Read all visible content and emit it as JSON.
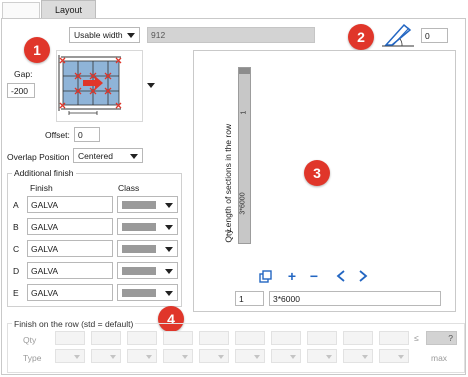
{
  "tabs": {
    "active": "Layout"
  },
  "top": {
    "width_mode": "Usable width",
    "width_value": "912",
    "angle_value": "0"
  },
  "badges": [
    "1",
    "2",
    "3",
    "4"
  ],
  "left": {
    "gap_label": "Gap:",
    "gap_value": "-200",
    "offset_label": "Offset:",
    "offset_value": "0",
    "overlap_label": "Overlap Position",
    "overlap_value": "Centered"
  },
  "additional_finish": {
    "title": "Additional finish",
    "col_finish": "Finish",
    "col_class": "Class",
    "rows": [
      {
        "letter": "A",
        "finish": "GALVA"
      },
      {
        "letter": "B",
        "finish": "GALVA"
      },
      {
        "letter": "C",
        "finish": "GALVA"
      },
      {
        "letter": "D",
        "finish": "GALVA"
      },
      {
        "letter": "E",
        "finish": "GALVA"
      }
    ]
  },
  "sections": {
    "header_text": "Length of sections in the row",
    "qty_label": "Qty",
    "column_length": "3*6000",
    "column_qty": "1",
    "qty_field": "1",
    "length_field": "3*6000"
  },
  "finish_row": {
    "title": "Finish on the row (std = default)",
    "qty_label": "Qty",
    "type_label": "Type",
    "le_symbol": "≤",
    "q_value": "?",
    "max_label": "max"
  },
  "colors": {
    "badge": "#e0362a",
    "nav_icon": "#2366c2",
    "layout_arrow": "#e0362a",
    "diagram_bg": "#8fb4d8"
  },
  "icons": [
    "chevron-down-icon",
    "angle-icon",
    "copy-icon",
    "plus-icon",
    "minus-icon",
    "chevron-left-icon",
    "chevron-right-icon"
  ]
}
